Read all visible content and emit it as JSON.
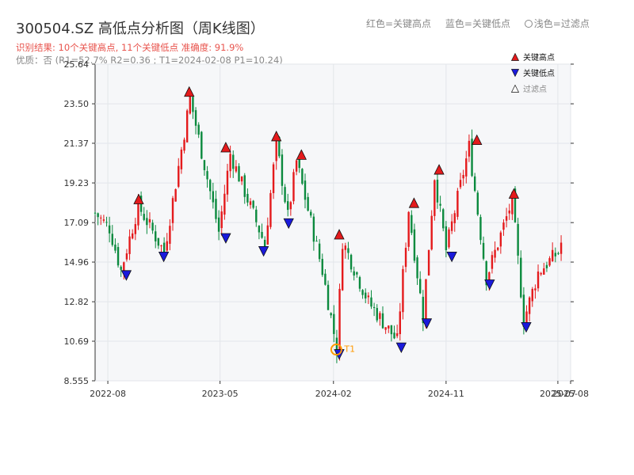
{
  "header": {
    "title": "300504.SZ 高低点分析图（周K线图）",
    "legend_red": "红色=关键高点",
    "legend_blue": "蓝色=关键低点",
    "legend_light": "浅色=过滤点",
    "result_line": "识别结果: 10个关键高点, 11个关键低点   准确度: 91.9%",
    "quality_line": "优质：否  (R1=52.7%  R2=0.36 ; T1=2024-02-08 P1=10.24)"
  },
  "colors": {
    "up": "#e41a1c",
    "down": "#0b8a3e",
    "high_marker": "#e41a1c",
    "low_marker": "#1a1adb",
    "t1_marker": "#ff9900",
    "grid": "#e3e6ea",
    "plot_bg": "#f6f7f9"
  },
  "chart_data": {
    "type": "candlestick",
    "title": "300504.SZ 高低点分析图（周K线图）",
    "ylim": [
      8.555,
      25.64
    ],
    "y_ticks": [
      "25.64",
      "23.50",
      "21.37",
      "19.23",
      "17.09",
      "14.96",
      "12.82",
      "10.69",
      "8.555"
    ],
    "x_ticks": [
      "2022-08",
      "2023-05",
      "2024-02",
      "2024-11",
      "2025-07",
      "2025-08"
    ],
    "x_range": [
      "2022-07",
      "2025-08"
    ],
    "legend": [
      "关键高点",
      "关键低点",
      "过滤点"
    ],
    "key_highs": [
      {
        "date": "2022-10",
        "price": 18.1
      },
      {
        "date": "2023-02",
        "price": 23.9
      },
      {
        "date": "2023-05",
        "price": 20.9
      },
      {
        "date": "2023-09",
        "price": 21.5
      },
      {
        "date": "2023-11",
        "price": 20.5
      },
      {
        "date": "2024-02",
        "price": 16.2
      },
      {
        "date": "2024-08",
        "price": 17.9
      },
      {
        "date": "2024-10",
        "price": 19.7
      },
      {
        "date": "2025-01",
        "price": 21.3
      },
      {
        "date": "2025-04",
        "price": 18.4
      }
    ],
    "key_lows": [
      {
        "date": "2022-09",
        "price": 14.5
      },
      {
        "date": "2022-12",
        "price": 15.5
      },
      {
        "date": "2023-05",
        "price": 16.5
      },
      {
        "date": "2023-08",
        "price": 15.8
      },
      {
        "date": "2023-10",
        "price": 17.3
      },
      {
        "date": "2024-02",
        "price": 10.24
      },
      {
        "date": "2024-07",
        "price": 10.6
      },
      {
        "date": "2024-09",
        "price": 11.9
      },
      {
        "date": "2024-11",
        "price": 15.5
      },
      {
        "date": "2025-02",
        "price": 14.0
      },
      {
        "date": "2025-05",
        "price": 11.7
      }
    ],
    "t1": {
      "label": "T1",
      "date": "2024-02-08",
      "price": 10.24
    },
    "anchors": [
      [
        "2022-07-01",
        17.6
      ],
      [
        "2022-08-05",
        16.8
      ],
      [
        "2022-09-02",
        14.5
      ],
      [
        "2022-10-14",
        18.0
      ],
      [
        "2022-12-16",
        15.5
      ],
      [
        "2023-02-17",
        23.8
      ],
      [
        "2023-04-28",
        16.6
      ],
      [
        "2023-05-26",
        20.8
      ],
      [
        "2023-08-18",
        15.9
      ],
      [
        "2023-09-15",
        21.4
      ],
      [
        "2023-10-13",
        17.4
      ],
      [
        "2023-11-03",
        20.4
      ],
      [
        "2024-01-05",
        14.5
      ],
      [
        "2024-02-09",
        10.3
      ],
      [
        "2024-02-23",
        16.1
      ],
      [
        "2024-04-26",
        12.8
      ],
      [
        "2024-07-05",
        10.7
      ],
      [
        "2024-08-02",
        17.8
      ],
      [
        "2024-09-06",
        12.0
      ],
      [
        "2024-10-04",
        19.6
      ],
      [
        "2024-11-01",
        15.6
      ],
      [
        "2024-12-27",
        21.2
      ],
      [
        "2025-02-07",
        14.1
      ],
      [
        "2025-04-11",
        18.3
      ],
      [
        "2025-05-09",
        11.8
      ],
      [
        "2025-06-13",
        14.4
      ],
      [
        "2025-08-01",
        15.5
      ],
      [
        "2025-08-08",
        16.0
      ]
    ]
  }
}
